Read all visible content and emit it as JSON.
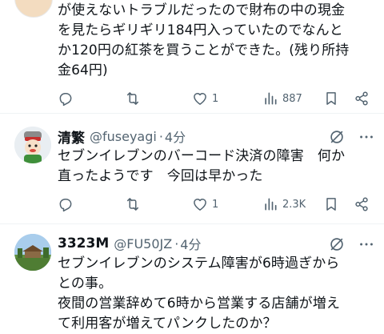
{
  "tweets": [
    {
      "name": "",
      "handle": "",
      "time": "",
      "text": "が使えないトラブルだったので財布の中の現金\nを見たらギリギリ184円入っていたのでなんと\nか120円の紅茶を買うことができた。(残り所持\n金64円)",
      "likes": "1",
      "views": "887"
    },
    {
      "name": "清繁",
      "handle": "@fuseyagi",
      "sep": "·",
      "time": "4分",
      "text": "セブンイレブンのバーコード決済の障害　何か\n直ったようです　今回は早かった",
      "likes": "1",
      "views": "2.3K"
    },
    {
      "name": "3323M",
      "handle": "@FU50JZ",
      "sep": "·",
      "time": "4分",
      "text": "セブンイレブンのシステム障害が6時過ぎから\nとの事。\n夜間の営業辞めて6時から営業する店舗が増え\nて利用客が増えてパンクしたのか？"
    }
  ],
  "colors": {
    "text": "#0f1419",
    "secondary": "#536471",
    "divider": "#eff3f4"
  },
  "icons": [
    "reply-icon",
    "retweet-icon",
    "like-icon",
    "views-icon",
    "bookmark-icon",
    "share-icon",
    "grok-icon",
    "more-icon"
  ]
}
